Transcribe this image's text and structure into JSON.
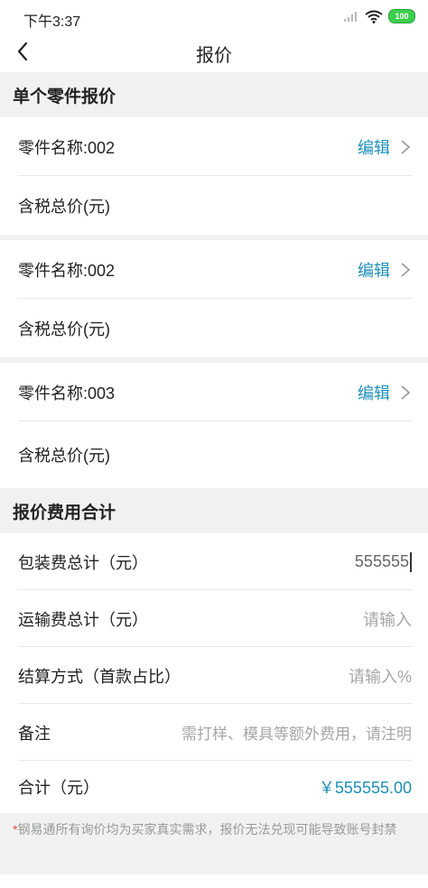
{
  "status_bar": {
    "time": "下午3:37",
    "battery": "100"
  },
  "nav": {
    "title": "报价"
  },
  "section_single": {
    "title": "单个零件报价"
  },
  "parts": [
    {
      "name": "零件名称:002",
      "edit": "编辑",
      "total_label": "含税总价(元)"
    },
    {
      "name": "零件名称:002",
      "edit": "编辑",
      "total_label": "含税总价(元)"
    },
    {
      "name": "零件名称:003",
      "edit": "编辑",
      "total_label": "含税总价(元)"
    }
  ],
  "section_fees": {
    "title": "报价费用合计"
  },
  "fees": {
    "packing_label": "包装费总计（元）",
    "packing_value": "555555",
    "shipping_label": "运输费总计（元）",
    "shipping_placeholder": "请输入",
    "settlement_label": "结算方式（首款占比）",
    "settlement_placeholder": "请输入%",
    "remarks_label": "备注",
    "remarks_placeholder": "需打样、模具等额外费用，请注明",
    "total_label": "合计（元）",
    "total_value": "￥555555.00"
  },
  "notice": {
    "star": "*",
    "text": "钢易通所有询价均为买家真实需求，报价无法兑现可能导致账号封禁"
  },
  "colors": {
    "accent": "#1e8fb8",
    "section_bg": "#f0f2f2",
    "required": "#e24b3a"
  }
}
